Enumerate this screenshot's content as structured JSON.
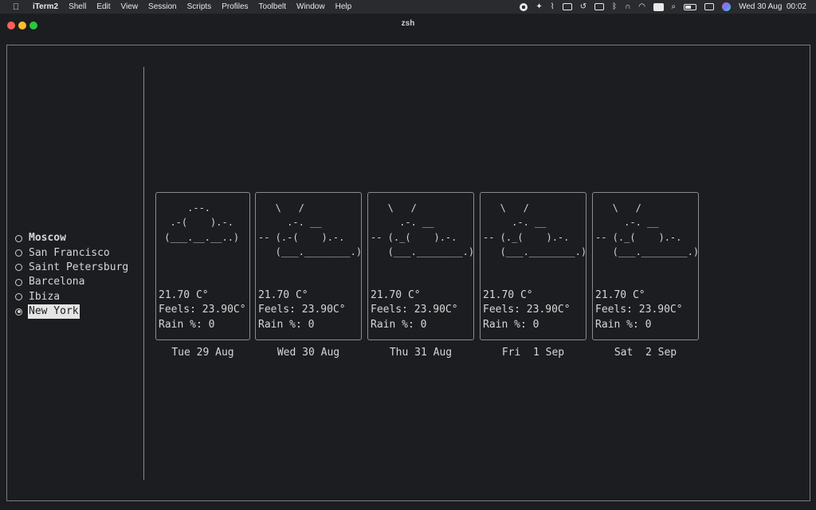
{
  "menubar": {
    "app": "iTerm2",
    "items": [
      "Shell",
      "Edit",
      "View",
      "Session",
      "Scripts",
      "Profiles",
      "Toolbelt",
      "Window",
      "Help"
    ],
    "clock": "Wed 30 Aug  00:02",
    "input_source": "A"
  },
  "window": {
    "title": "zsh"
  },
  "cities": [
    {
      "name": "Moscow",
      "selected": false
    },
    {
      "name": "San Francisco",
      "selected": false
    },
    {
      "name": "Saint Petersburg",
      "selected": false
    },
    {
      "name": "Barcelona",
      "selected": false
    },
    {
      "name": "Ibiza",
      "selected": false
    },
    {
      "name": "New York",
      "selected": true
    }
  ],
  "days": [
    {
      "label": "Tue 29 Aug",
      "art": "     .--.\n  .-(    ).-.\n (___.__.__..)",
      "temp": "21.70 C°",
      "feels": "Feels: 23.90C°",
      "rain": "Rain %: 0"
    },
    {
      "label": "Wed 30 Aug",
      "art": "   \\   /\n     .-. __\n-- (.-(    ).-.\n   (___.________.)",
      "temp": "21.70 C°",
      "feels": "Feels: 23.90C°",
      "rain": "Rain %: 0"
    },
    {
      "label": "Thu 31 Aug",
      "art": "   \\   /\n     .-. __\n-- (._(    ).-.\n   (___.________.)",
      "temp": "21.70 C°",
      "feels": "Feels: 23.90C°",
      "rain": "Rain %: 0"
    },
    {
      "label": "Fri  1 Sep",
      "art": "   \\   /\n     .-. __\n-- (._(    ).-.\n   (___.________.)",
      "temp": "21.70 C°",
      "feels": "Feels: 23.90C°",
      "rain": "Rain %: 0"
    },
    {
      "label": "Sat  2 Sep",
      "art": "   \\   /\n     .-. __\n-- (._(    ).-.\n   (___.________.)",
      "temp": "21.70 C°",
      "feels": "Feels: 23.90C°",
      "rain": "Rain %: 0"
    }
  ],
  "colors": {
    "background": "#1c1d20",
    "text": "#d6d6d6",
    "border": "#8a8b8f"
  }
}
